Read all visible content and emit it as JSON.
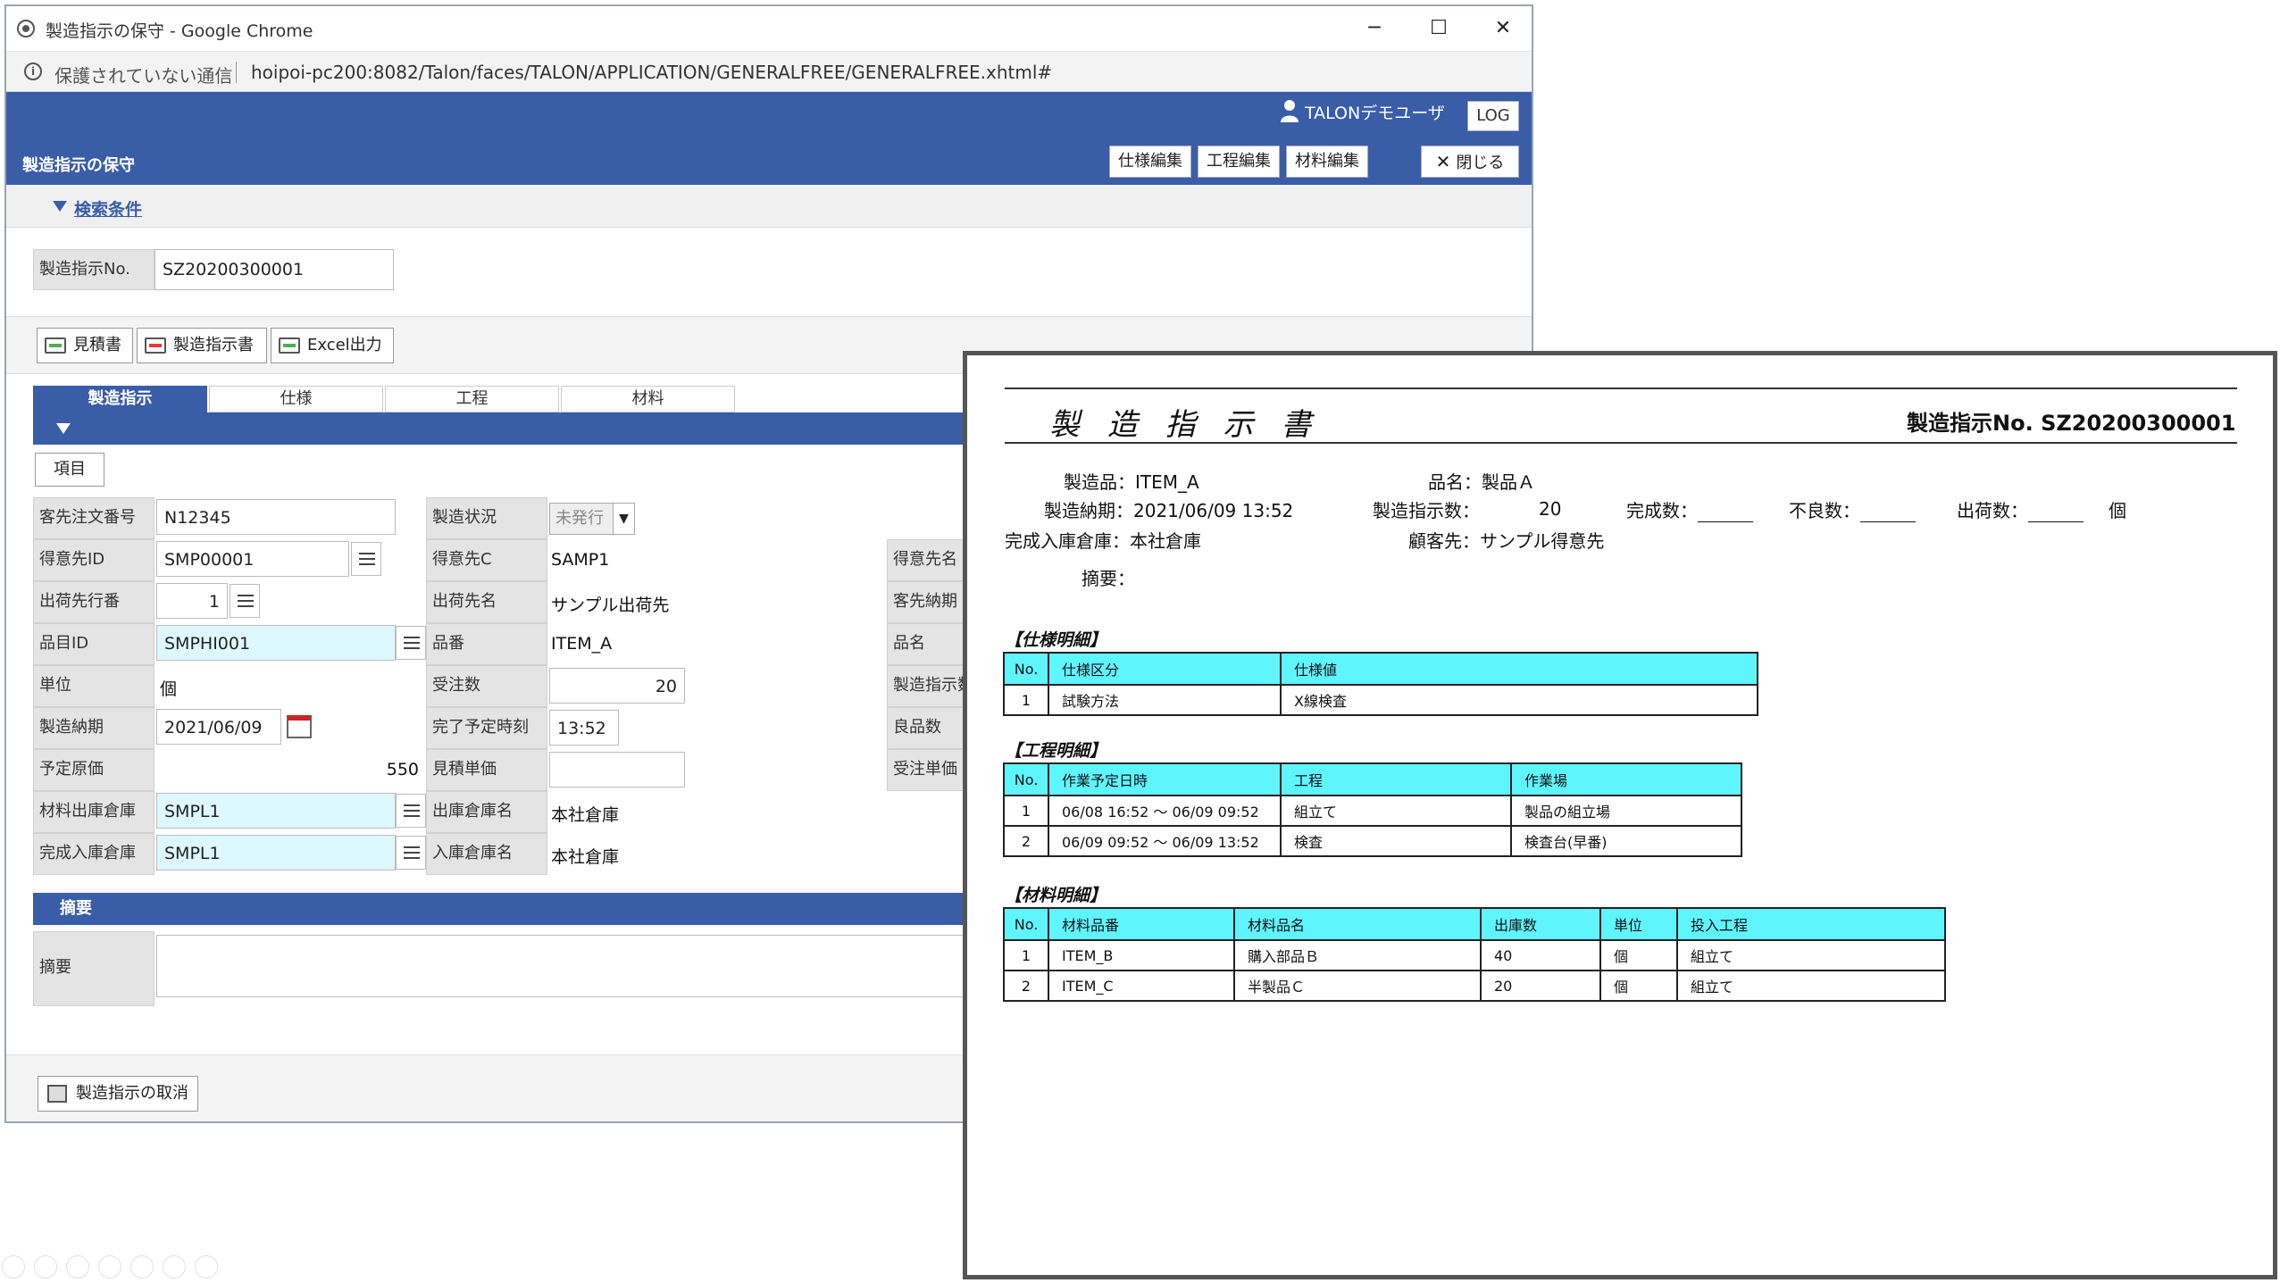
{
  "browser": {
    "title": "製造指示の保守 - Google Chrome",
    "insecure": "保護されていない通信",
    "url": "hoipoi-pc200:8082/Talon/faces/TALON/APPLICATION/GENERALFREE/GENERALFREE.xhtml#",
    "minimize": "─",
    "maximize": "☐",
    "close": "✕"
  },
  "header": {
    "user": "TALONデモユーザ",
    "log": "LOG",
    "screen_title": "製造指示の保守",
    "buttons": [
      "仕様編集",
      "工程編集",
      "材料編集"
    ],
    "close_label": "閉じる"
  },
  "search": {
    "toggle": "検索条件",
    "label": "製造指示No.",
    "value": "SZ20200300001"
  },
  "output": {
    "estimate": "見積書",
    "instruction": "製造指示書",
    "excel": "Excel出力"
  },
  "tabs": [
    "製造指示",
    "仕様",
    "工程",
    "材料"
  ],
  "form": {
    "item_button": "項目",
    "customer_order_label": "客先注文番号",
    "customer_order": "N12345",
    "status_label": "製造状況",
    "status": "未発行",
    "customer_id_label": "得意先ID",
    "customer_id": "SMP00001",
    "customer_c_label": "得意先C",
    "customer_c": "SAMP1",
    "customer_name_label": "得意先名",
    "ship_seq_label": "出荷先行番",
    "ship_seq": "1",
    "ship_name_label": "出荷先名",
    "ship_name": "サンプル出荷先",
    "customer_due_label": "客先納期",
    "item_id_label": "品目ID",
    "item_id": "SMPHI001",
    "item_no_label": "品番",
    "item_no": "ITEM_A",
    "item_name_label": "品名",
    "unit_label": "単位",
    "unit": "個",
    "order_qty_label": "受注数",
    "order_qty": "20",
    "instr_qty_label": "製造指示数",
    "due_label": "製造納期",
    "due": "2021/06/09",
    "finish_time_label": "完了予定時刻",
    "finish_time": "13:52",
    "good_qty_label": "良品数",
    "cost_label": "予定原価",
    "cost": "550",
    "est_price_label": "見積単価",
    "est_price": "",
    "order_price_label": "受注単価",
    "mat_wh_label": "材料出庫倉庫",
    "mat_wh": "SMPL1",
    "out_wh_name_label": "出庫倉庫名",
    "out_wh_name": "本社倉庫",
    "fin_wh_label": "完成入庫倉庫",
    "fin_wh": "SMPL1",
    "in_wh_name_label": "入庫倉庫名",
    "in_wh_name": "本社倉庫"
  },
  "memo": {
    "section": "摘要",
    "label": "摘要",
    "value": ""
  },
  "footer": {
    "cancel": "製造指示の取消"
  },
  "report": {
    "title": "製 造 指 示 書",
    "no_label": "製造指示No.",
    "no_value": "SZ20200300001",
    "product": "製造品：ITEM_A",
    "item_name": "品名：製品Ａ",
    "due": "製造納期：2021/06/09 13:52",
    "instr_qty_label": "製造指示数：",
    "instr_qty": "20",
    "done_label": "完成数：",
    "defect_label": "不良数：",
    "ship_label": "出荷数：",
    "ship_unit": "個",
    "warehouse": "完成入庫倉庫：本社倉庫",
    "customer": "顧客先：サンプル得意先",
    "memo": "摘要：",
    "spec_section": "【仕様明細】",
    "spec_headers": [
      "No.",
      "仕様区分",
      "仕様値"
    ],
    "spec_rows": [
      [
        "1",
        "試験方法",
        "X線検査"
      ]
    ],
    "proc_section": "【工程明細】",
    "proc_headers": [
      "No.",
      "作業予定日時",
      "工程",
      "作業場"
    ],
    "proc_rows": [
      [
        "1",
        "06/08 16:52 ～ 06/09 09:52",
        "組立て",
        "製品の組立場"
      ],
      [
        "2",
        "06/09 09:52 ～ 06/09 13:52",
        "検査",
        "検査台(早番)"
      ]
    ],
    "mat_section": "【材料明細】",
    "mat_headers": [
      "No.",
      "材料品番",
      "材料品名",
      "出庫数",
      "単位",
      "投入工程"
    ],
    "mat_rows": [
      [
        "1",
        "ITEM_B",
        "購入部品Ｂ",
        "40",
        "個",
        "組立て"
      ],
      [
        "2",
        "ITEM_C",
        "半製品Ｃ",
        "20",
        "個",
        "組立て"
      ]
    ]
  }
}
